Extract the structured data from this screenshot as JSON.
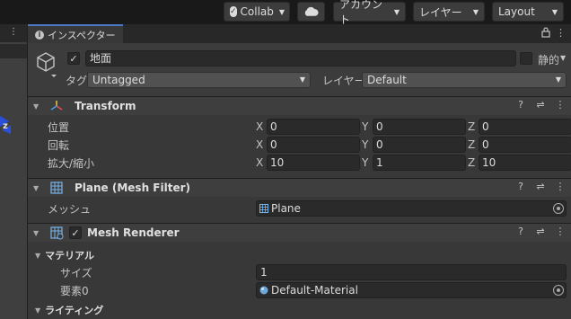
{
  "toolbar": {
    "collab_label": "Collab",
    "account_label": "アカウント",
    "layers_label": "レイヤー",
    "layout_label": "Layout"
  },
  "left_strip": {
    "menu_glyph": "⋮",
    "axis_label": "z"
  },
  "inspector": {
    "tab_label": "インスペクター",
    "object_name": "地面",
    "static_label": "静的",
    "tag_label": "タグ",
    "tag_value": "Untagged",
    "layer_label": "レイヤー",
    "layer_value": "Default"
  },
  "transform": {
    "title": "Transform",
    "position_label": "位置",
    "rotation_label": "回転",
    "scale_label": "拡大/縮小",
    "axes": [
      "X",
      "Y",
      "Z"
    ],
    "position": [
      "0",
      "0",
      "0"
    ],
    "rotation": [
      "0",
      "0",
      "0"
    ],
    "scale": [
      "10",
      "1",
      "10"
    ]
  },
  "mesh_filter": {
    "title": "Plane (Mesh Filter)",
    "mesh_label": "メッシュ",
    "mesh_value": "Plane"
  },
  "mesh_renderer": {
    "title": "Mesh Renderer",
    "materials_label": "マテリアル",
    "size_label": "サイズ",
    "size_value": "1",
    "element_label": "要素0",
    "element_value": "Default-Material",
    "lighting_label": "ライティング"
  },
  "colors": {
    "accent": "#4c7ac8",
    "panel": "#383838",
    "field": "#2a2a2a"
  }
}
